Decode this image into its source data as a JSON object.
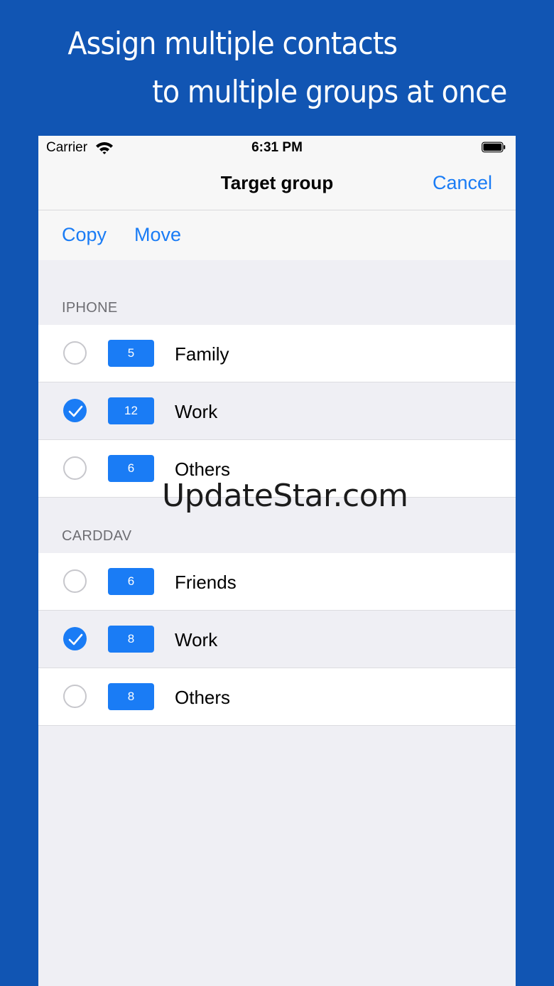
{
  "headline": {
    "line1": "Assign multiple contacts",
    "line2": "to multiple groups at once"
  },
  "status_bar": {
    "carrier": "Carrier",
    "time": "6:31 PM",
    "icons": [
      "wifi-icon",
      "battery-icon"
    ]
  },
  "nav": {
    "title": "Target group",
    "cancel_label": "Cancel"
  },
  "actions": {
    "copy_label": "Copy",
    "move_label": "Move"
  },
  "sections": [
    {
      "header": "IPHONE",
      "rows": [
        {
          "count": "5",
          "name": "Family",
          "checked": false
        },
        {
          "count": "12",
          "name": "Work",
          "checked": true
        },
        {
          "count": "6",
          "name": "Others",
          "checked": false
        }
      ]
    },
    {
      "header": "CARDDAV",
      "rows": [
        {
          "count": "6",
          "name": "Friends",
          "checked": false
        },
        {
          "count": "8",
          "name": "Work",
          "checked": true
        },
        {
          "count": "8",
          "name": "Others",
          "checked": false
        }
      ]
    }
  ],
  "watermark": "UpdateStar.com",
  "colors": {
    "background": "#1155b3",
    "accent": "#1a7cf5",
    "list_background": "#efeff4"
  }
}
